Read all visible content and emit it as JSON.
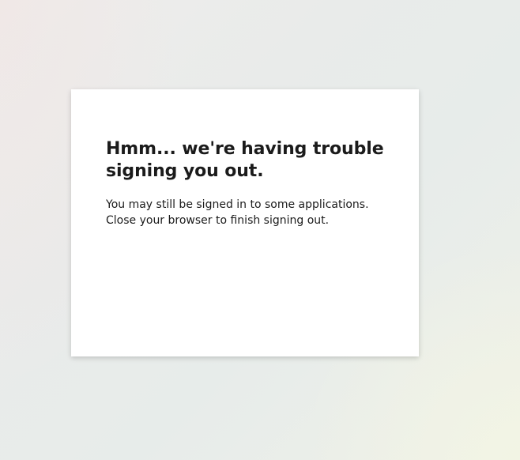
{
  "signout_error": {
    "title": "Hmm... we're having trouble signing you out.",
    "message_line1": "You may still be signed in to some applications.",
    "message_line2": "Close your browser to finish signing out."
  },
  "colors": {
    "card_background": "#ffffff",
    "text": "#1b1b1b",
    "page_background": "#e9ebea"
  }
}
